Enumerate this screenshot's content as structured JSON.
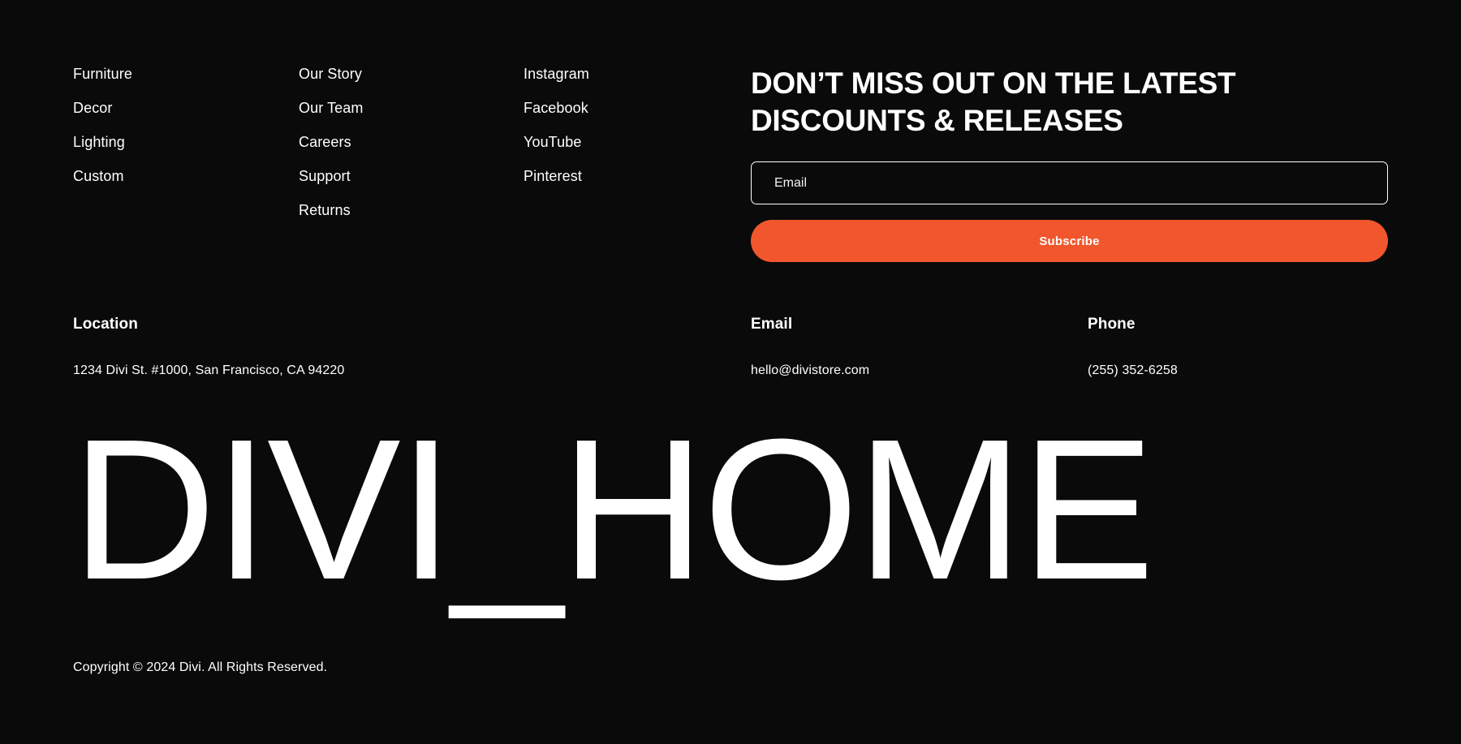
{
  "theme": {
    "background": "#0a0a0a",
    "text": "#ffffff",
    "accent": "#f1562c"
  },
  "nav_columns": [
    {
      "name": "shop",
      "items": [
        {
          "label": "Furniture"
        },
        {
          "label": "Decor"
        },
        {
          "label": "Lighting"
        },
        {
          "label": "Custom"
        }
      ]
    },
    {
      "name": "company",
      "items": [
        {
          "label": "Our Story"
        },
        {
          "label": "Our Team"
        },
        {
          "label": "Careers"
        },
        {
          "label": "Support"
        },
        {
          "label": "Returns"
        }
      ]
    },
    {
      "name": "social",
      "items": [
        {
          "label": "Instagram"
        },
        {
          "label": "Facebook"
        },
        {
          "label": "YouTube"
        },
        {
          "label": "Pinterest"
        }
      ]
    }
  ],
  "newsletter": {
    "heading": "DON’T MISS OUT ON THE LATEST DISCOUNTS & RELEASES",
    "email_placeholder": "Email",
    "email_value": "",
    "subscribe_label": "Subscribe"
  },
  "contact": {
    "location": {
      "label": "Location",
      "value": "1234 Divi St. #1000, San Francisco, CA 94220"
    },
    "email": {
      "label": "Email",
      "value": "hello@divistore.com"
    },
    "phone": {
      "label": "Phone",
      "value": "(255) 352-6258"
    }
  },
  "wordmark": "DIVI_HOME",
  "copyright": "Copyright © 2024 Divi. All Rights Reserved."
}
